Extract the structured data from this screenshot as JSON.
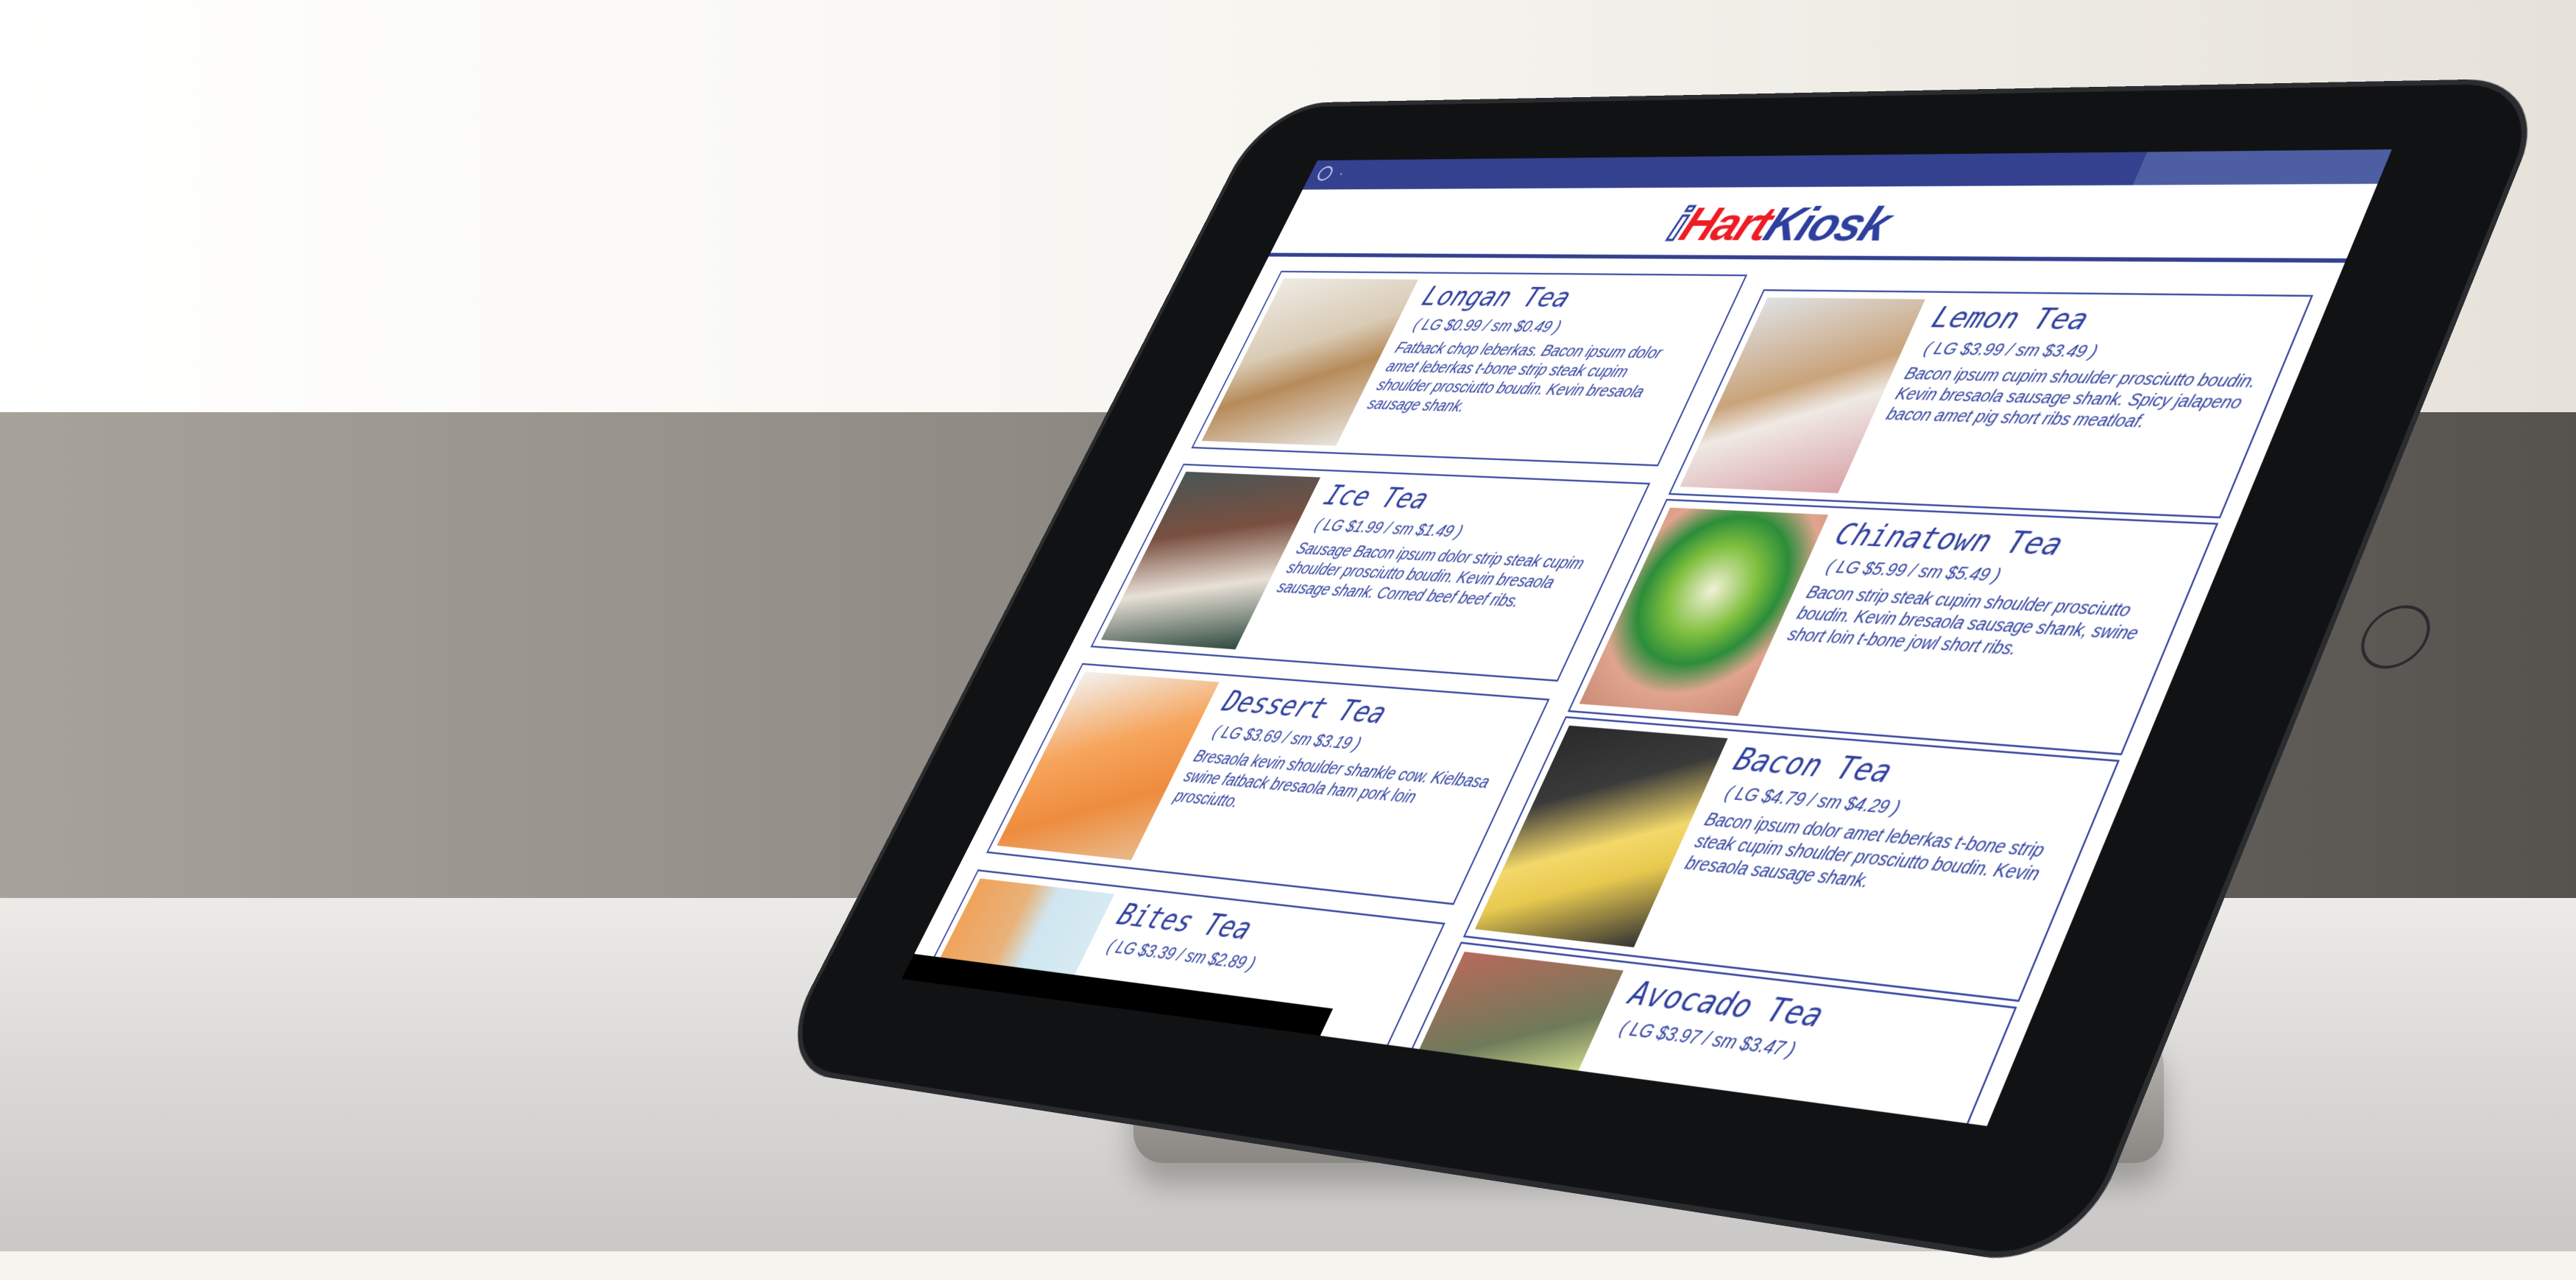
{
  "app": {
    "status_icon": "settings-icon",
    "status_text": "·"
  },
  "logo": {
    "i": "i",
    "hart": "Hart",
    "kiosk": "Kiosk",
    "colors": {
      "hart": "#ee1c24",
      "kiosk": "#2e3f9e"
    }
  },
  "theme": {
    "accent": "#33418f",
    "text": "#2e3f9e"
  },
  "menu": [
    {
      "name": "Longan Tea",
      "price": "( LG $0.99 / sm $0.49 )",
      "desc": "Fatback chop leberkas. Bacon ipsum dolor amet leberkas t-bone strip steak cupim shoulder prosciutto boudin. Kevin bresaola sausage shank."
    },
    {
      "name": "Lemon Tea",
      "price": "( LG $3.99 / sm $3.49 )",
      "desc": "Bacon ipsum cupim shoulder prosciutto boudin. Kevin bresaola sausage shank. Spicy jalapeno bacon amet pig short ribs meatloaf."
    },
    {
      "name": "Ice Tea",
      "price": "( LG $1.99 / sm $1.49 )",
      "desc": "Sausage Bacon ipsum dolor strip steak cupim shoulder prosciutto boudin. Kevin bresaola sausage shank. Corned beef beef ribs."
    },
    {
      "name": "Chinatown Tea",
      "price": "( LG $5.99 / sm $5.49 )",
      "desc": "Bacon strip steak cupim shoulder prosciutto boudin. Kevin bresaola sausage shank, swine short loin t-bone jowl short ribs."
    },
    {
      "name": "Dessert Tea",
      "price": "( LG $3.69 / sm $3.19 )",
      "desc": "Bresaola kevin shoulder shankle cow. Kielbasa swine fatback bresaola ham pork loin prosciutto."
    },
    {
      "name": "Bacon Tea",
      "price": "( LG $4.79 / sm $4.29 )",
      "desc": "Bacon ipsum dolor amet leberkas t-bone strip steak cupim shoulder prosciutto boudin. Kevin bresaola sausage shank."
    },
    {
      "name": "Bites Tea",
      "price": "( LG $3.39 / sm $2.89 )",
      "desc": ""
    },
    {
      "name": "Avocado Tea",
      "price": "( LG $3.97 / sm $3.47 )",
      "desc": ""
    }
  ]
}
